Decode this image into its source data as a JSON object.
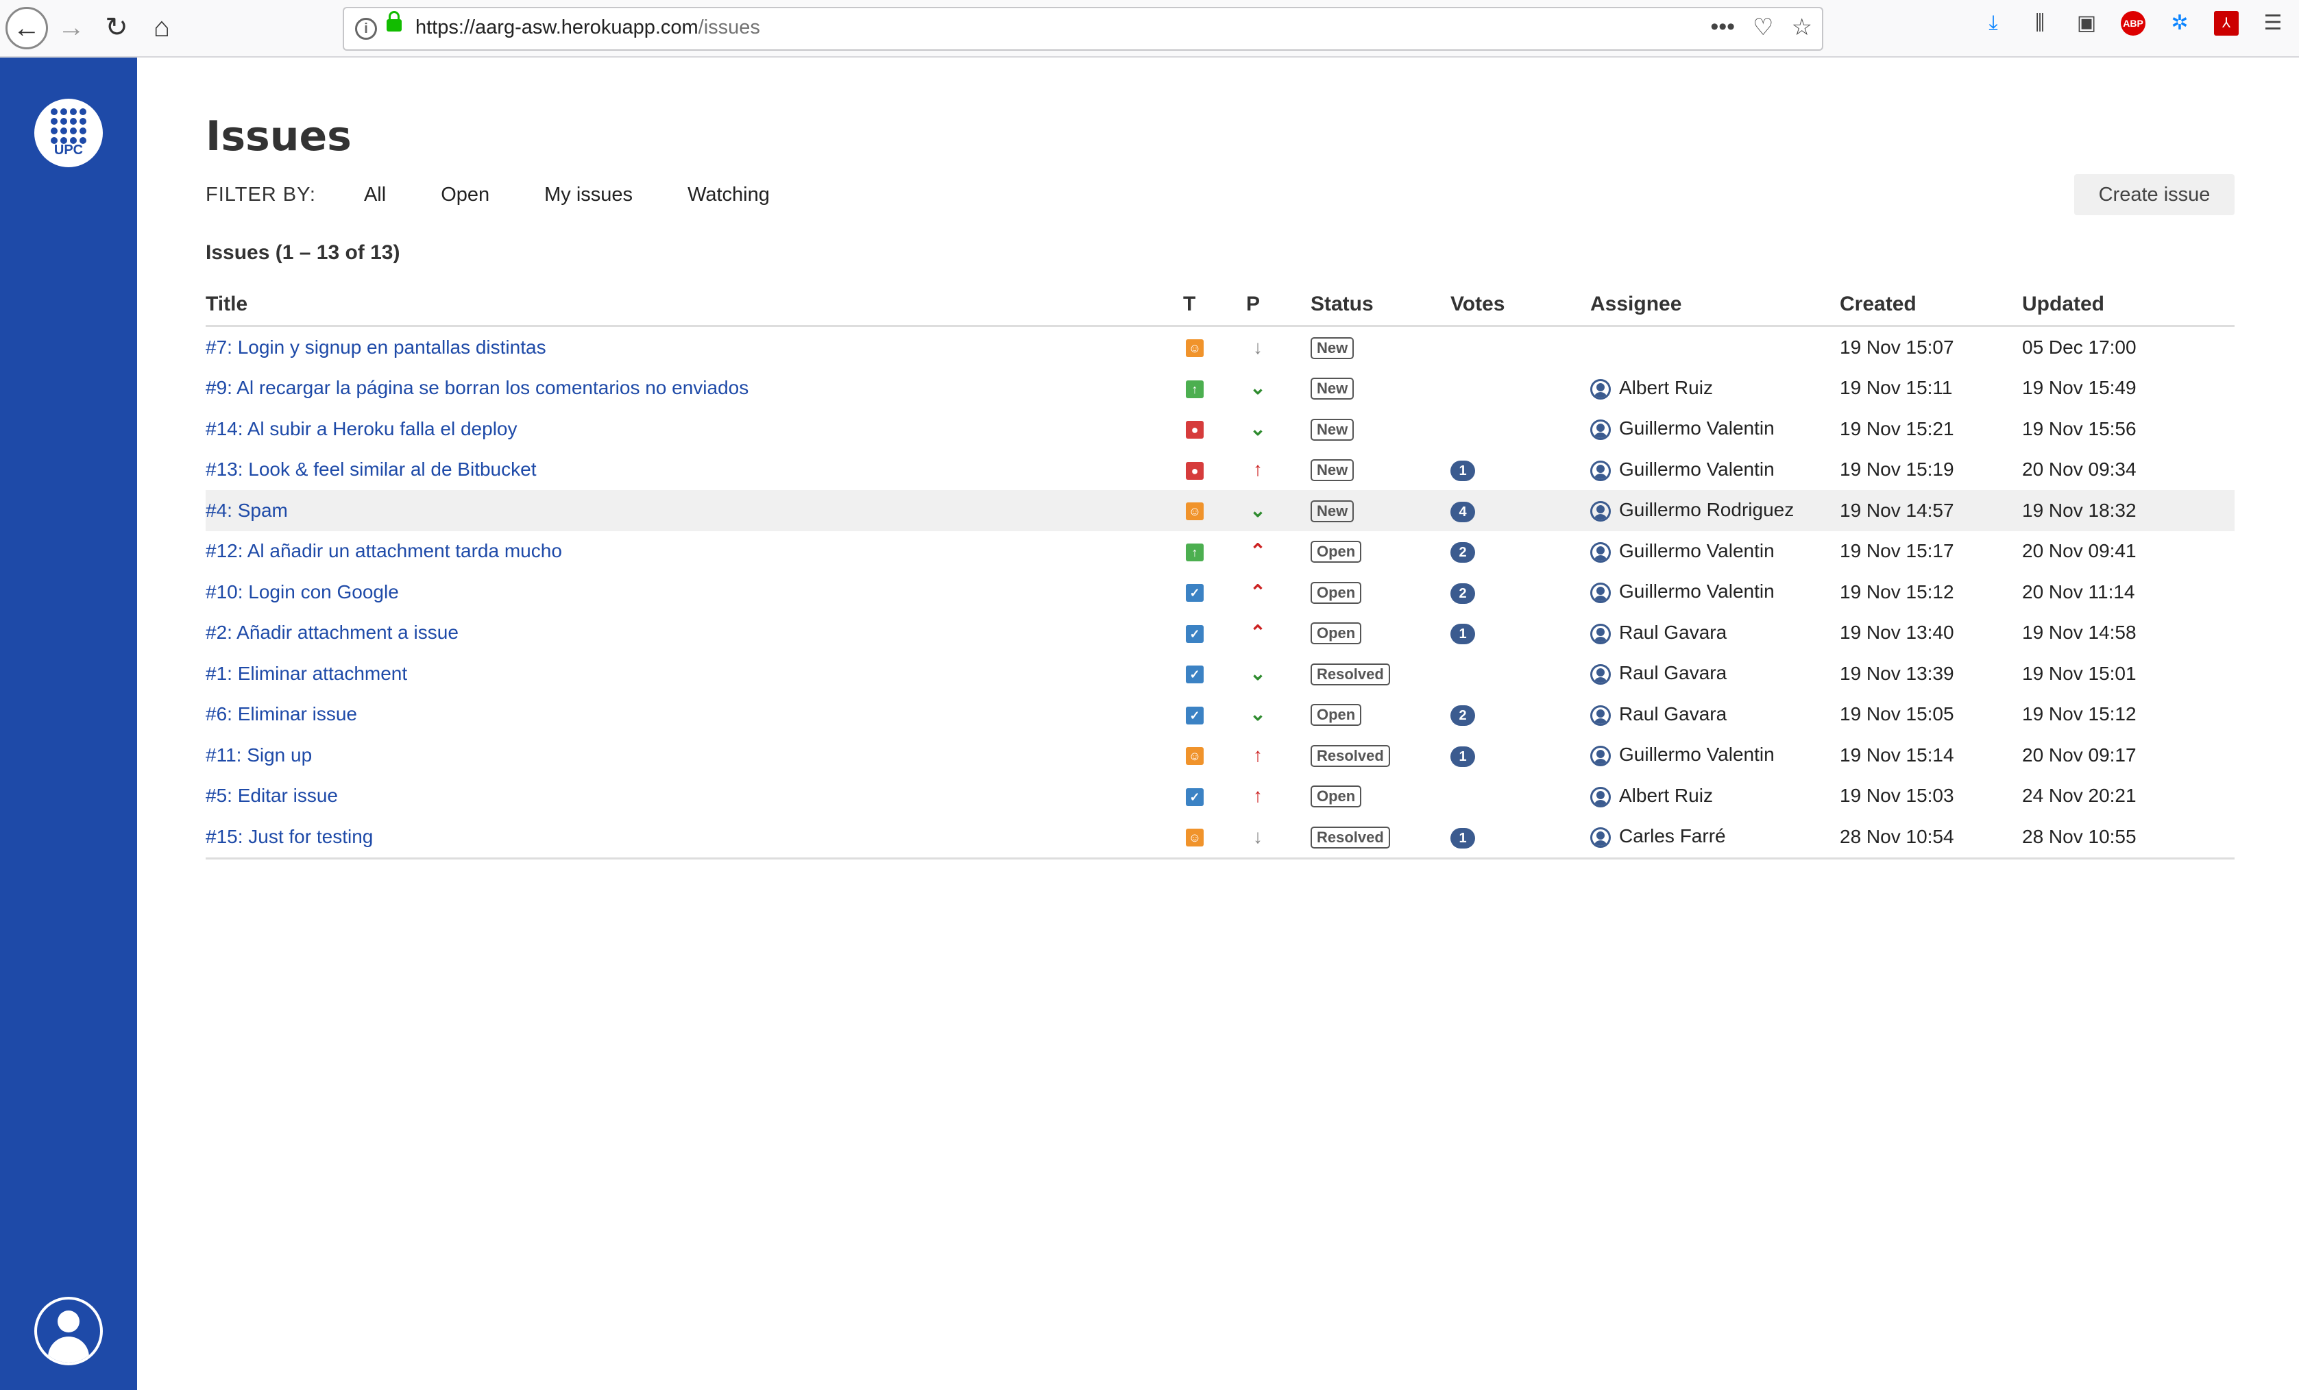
{
  "browser": {
    "url_host": "https://aarg-asw.herokuapp.com",
    "url_path": "/issues"
  },
  "sidebar": {
    "logo_text": "UPC"
  },
  "page": {
    "title": "Issues",
    "filter_label": "FILTER BY:",
    "filters": [
      "All",
      "Open",
      "My issues",
      "Watching"
    ],
    "create_label": "Create issue",
    "count_label": "Issues (1 – 13 of 13)"
  },
  "columns": [
    "Title",
    "T",
    "P",
    "Status",
    "Votes",
    "Assignee",
    "Created",
    "Updated"
  ],
  "type_colors": {
    "proposal": "#f0932b",
    "enhancement": "#4caf50",
    "bug": "#d63c3c",
    "task": "#3b82c4"
  },
  "priority_colors": {
    "trivial": "#888888",
    "minor": "#2e8b2e",
    "major": "#cc2222",
    "critical": "#cc2222"
  },
  "issues": [
    {
      "title": "#7: Login y signup en pantallas distintas",
      "type": "proposal",
      "priority": "trivial",
      "status": "New",
      "votes": "",
      "assignee": "",
      "created": "19 Nov 15:07",
      "updated": "05 Dec 17:00"
    },
    {
      "title": "#9: Al recargar la página se borran los comentarios no enviados",
      "type": "enhancement",
      "priority": "minor",
      "status": "New",
      "votes": "",
      "assignee": "Albert Ruiz",
      "created": "19 Nov 15:11",
      "updated": "19 Nov 15:49"
    },
    {
      "title": "#14: Al subir a Heroku falla el deploy",
      "type": "bug",
      "priority": "minor",
      "status": "New",
      "votes": "",
      "assignee": "Guillermo Valentin",
      "created": "19 Nov 15:21",
      "updated": "19 Nov 15:56"
    },
    {
      "title": "#13: Look & feel similar al de Bitbucket",
      "type": "bug",
      "priority": "major",
      "status": "New",
      "votes": "1",
      "assignee": "Guillermo Valentin",
      "created": "19 Nov 15:19",
      "updated": "20 Nov 09:34"
    },
    {
      "title": "#4: Spam",
      "type": "proposal",
      "priority": "minor",
      "status": "New",
      "votes": "4",
      "assignee": "Guillermo Rodriguez",
      "created": "19 Nov 14:57",
      "updated": "19 Nov 18:32"
    },
    {
      "title": "#12: Al añadir un attachment tarda mucho",
      "type": "enhancement",
      "priority": "critical",
      "status": "Open",
      "votes": "2",
      "assignee": "Guillermo Valentin",
      "created": "19 Nov 15:17",
      "updated": "20 Nov 09:41"
    },
    {
      "title": "#10: Login con Google",
      "type": "task",
      "priority": "critical",
      "status": "Open",
      "votes": "2",
      "assignee": "Guillermo Valentin",
      "created": "19 Nov 15:12",
      "updated": "20 Nov 11:14"
    },
    {
      "title": "#2: Añadir attachment a issue",
      "type": "task",
      "priority": "critical",
      "status": "Open",
      "votes": "1",
      "assignee": "Raul Gavara",
      "created": "19 Nov 13:40",
      "updated": "19 Nov 14:58"
    },
    {
      "title": "#1: Eliminar attachment",
      "type": "task",
      "priority": "minor",
      "status": "Resolved",
      "votes": "",
      "assignee": "Raul Gavara",
      "created": "19 Nov 13:39",
      "updated": "19 Nov 15:01"
    },
    {
      "title": "#6: Eliminar issue",
      "type": "task",
      "priority": "minor",
      "status": "Open",
      "votes": "2",
      "assignee": "Raul Gavara",
      "created": "19 Nov 15:05",
      "updated": "19 Nov 15:12"
    },
    {
      "title": "#11: Sign up",
      "type": "proposal",
      "priority": "major",
      "status": "Resolved",
      "votes": "1",
      "assignee": "Guillermo Valentin",
      "created": "19 Nov 15:14",
      "updated": "20 Nov 09:17"
    },
    {
      "title": "#5: Editar issue",
      "type": "task",
      "priority": "major",
      "status": "Open",
      "votes": "",
      "assignee": "Albert Ruiz",
      "created": "19 Nov 15:03",
      "updated": "24 Nov 20:21"
    },
    {
      "title": "#15: Just for testing",
      "type": "proposal",
      "priority": "trivial",
      "status": "Resolved",
      "votes": "1",
      "assignee": "Carles Farré",
      "created": "28 Nov 10:54",
      "updated": "28 Nov 10:55"
    }
  ],
  "highlighted_row": 4
}
